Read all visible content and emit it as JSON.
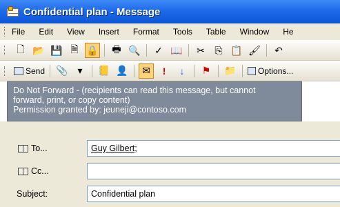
{
  "window": {
    "title": "Confidential plan - Message"
  },
  "menu": [
    "File",
    "Edit",
    "View",
    "Insert",
    "Format",
    "Tools",
    "Table",
    "Window",
    "He"
  ],
  "toolbar2": {
    "send_label": "Send",
    "options_label": "Options..."
  },
  "tooltip": {
    "line1": "Do Not Forward - (recipients can read this message, but cannot",
    "line2": "forward, print, or copy content)",
    "line3": "Permission granted by: jeuneji@contoso.com"
  },
  "fields": {
    "to_label": "To...",
    "to_value": "Guy Gilbert",
    "to_suffix": ";",
    "cc_label": "Cc...",
    "cc_value": "",
    "subject_label": "Subject:",
    "subject_value": "Confidential plan"
  },
  "colors": {
    "titlebar": "#0a56d8",
    "tooltip_bg": "#7f8a9a",
    "active_button": "#fbd27a"
  }
}
